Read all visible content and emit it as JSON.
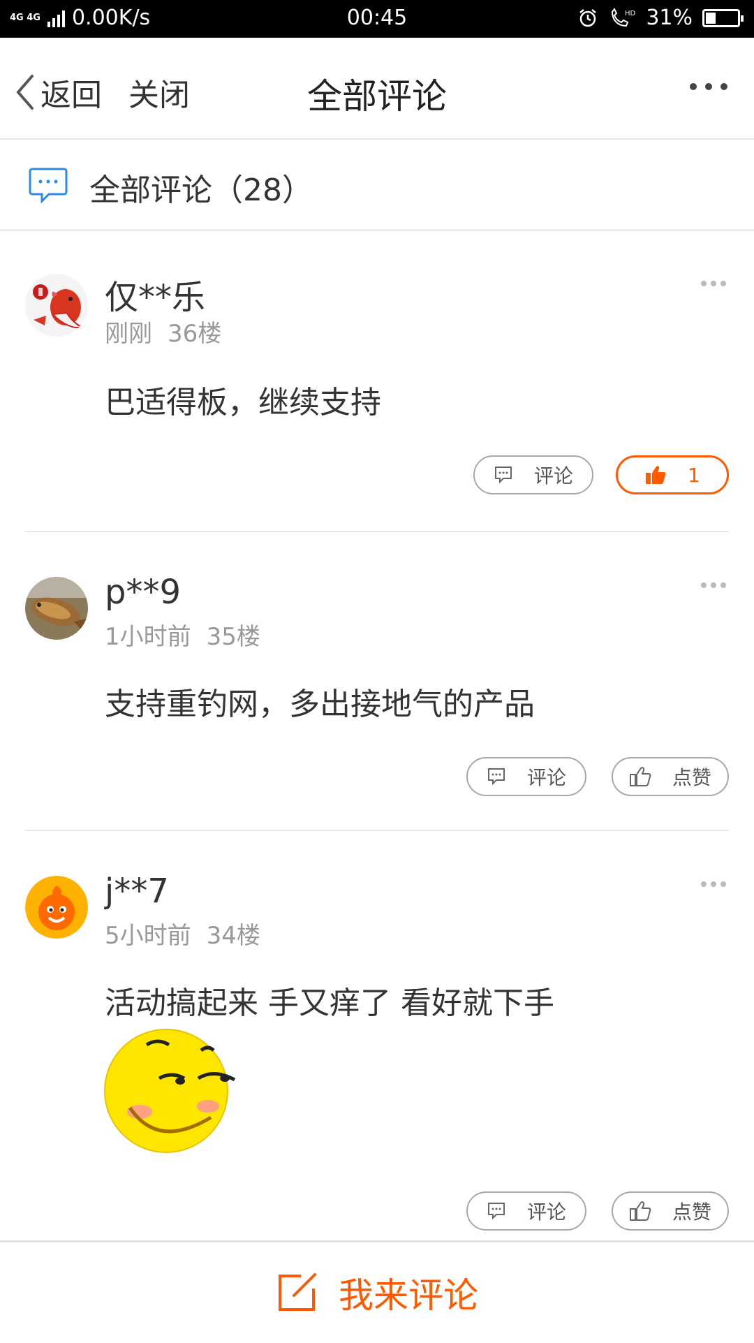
{
  "status_bar": {
    "network": "4G 4G",
    "speed": "0.00K/s",
    "time": "00:45",
    "battery": "31%",
    "battery_level": 0.31,
    "icons": [
      "alarm-icon",
      "hd-call-icon",
      "battery-icon"
    ]
  },
  "nav": {
    "back_label": "返回",
    "close_label": "关闭",
    "title": "全部评论",
    "more_icon": "more-horizontal-icon"
  },
  "section": {
    "title": "全部评论（28）",
    "icon": "comment-bubble-icon"
  },
  "comments": [
    {
      "user": "仅**乐",
      "time": "刚刚",
      "floor": "36楼",
      "text": "巴适得板，继续支持",
      "comment_label": "评论",
      "like_label": "1",
      "liked": true,
      "avatar": "koi-fish-avatar"
    },
    {
      "user": "p**9",
      "time": "1小时前",
      "floor": "35楼",
      "text": "支持重钓网，多出接地气的产品",
      "comment_label": "评论",
      "like_label": "点赞",
      "liked": false,
      "avatar": "fish-photo-avatar"
    },
    {
      "user": "j**7",
      "time": "5小时前",
      "floor": "34楼",
      "text": "活动搞起来 手又痒了 看好就下手",
      "emoji": "smirk-emoji",
      "comment_label": "评论",
      "like_label": "点赞",
      "liked": false,
      "avatar": "orange-mascot-avatar"
    }
  ],
  "bottom": {
    "write_label": "我来评论",
    "icon": "edit-icon"
  },
  "colors": {
    "accent": "#ff5a00",
    "text": "#333333",
    "muted": "#999999",
    "divider": "#e6e6e6",
    "blue_icon": "#2d8be6"
  }
}
